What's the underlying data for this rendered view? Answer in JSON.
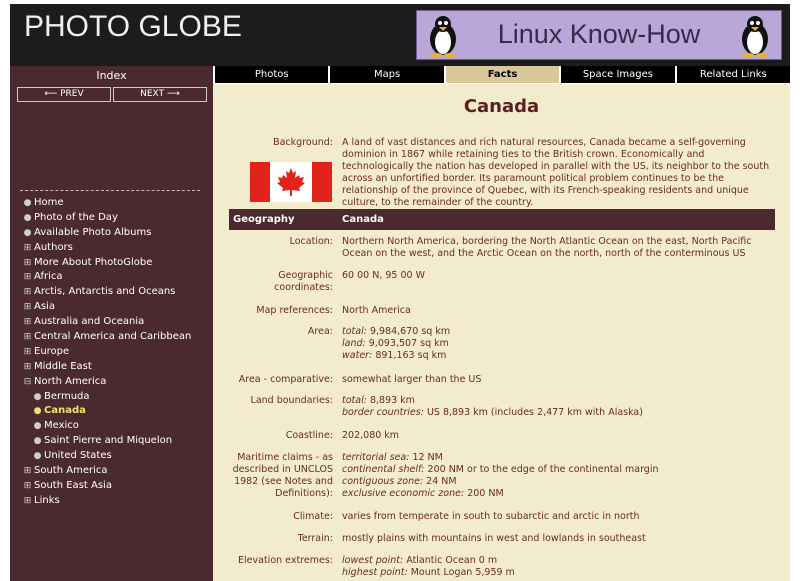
{
  "header": {
    "logo": "PHOTO GLOBE",
    "banner": "Linux Know-How"
  },
  "sidebar": {
    "index_label": "Index",
    "prev_label": "PREV",
    "next_label": "NEXT",
    "items": [
      {
        "label": "Home",
        "marker": "bullet"
      },
      {
        "label": "Photo of the Day",
        "marker": "bullet"
      },
      {
        "label": "Available Photo Albums",
        "marker": "bullet"
      },
      {
        "label": "Authors",
        "marker": "plus"
      },
      {
        "label": "More About PhotoGlobe",
        "marker": "plus"
      },
      {
        "label": "Africa",
        "marker": "plus"
      },
      {
        "label": "Arctis, Antarctis and Oceans",
        "marker": "plus"
      },
      {
        "label": "Asia",
        "marker": "plus"
      },
      {
        "label": "Australia and Oceania",
        "marker": "plus"
      },
      {
        "label": "Central America and Caribbean",
        "marker": "plus"
      },
      {
        "label": "Europe",
        "marker": "plus"
      },
      {
        "label": "Middle East",
        "marker": "plus"
      },
      {
        "label": "North America",
        "marker": "minus"
      },
      {
        "label": "Bermuda",
        "marker": "bullet",
        "sub": true
      },
      {
        "label": "Canada",
        "marker": "bullet",
        "sub": true,
        "active": true
      },
      {
        "label": "Mexico",
        "marker": "bullet",
        "sub": true
      },
      {
        "label": "Saint Pierre and Miquelon",
        "marker": "bullet",
        "sub": true
      },
      {
        "label": "United States",
        "marker": "bullet",
        "sub": true
      },
      {
        "label": "South America",
        "marker": "plus"
      },
      {
        "label": "South East Asia",
        "marker": "plus"
      },
      {
        "label": "Links",
        "marker": "plus"
      }
    ]
  },
  "tabs": [
    "Photos",
    "Maps",
    "Facts",
    "Space Images",
    "Related Links"
  ],
  "active_tab": "Facts",
  "content": {
    "title": "Canada",
    "background_label": "Background:",
    "background_text": "A land of vast distances and rich natural resources, Canada became a self-governing dominion in 1867 while retaining ties to the British crown. Economically and technologically the nation has developed in parallel with the US, its neighbor to the south across an unfortified border. Its paramount political problem continues to be the relationship of the province of Quebec, with its French-speaking residents and unique culture, to the remainder of the country.",
    "section_left": "Geography",
    "section_right": "Canada",
    "location_label": "Location:",
    "location_text": "Northern North America, bordering the North Atlantic Ocean on the east, North Pacific Ocean on the west, and the Arctic Ocean on the north, north of the conterminous US",
    "geo_label": "Geographic coordinates:",
    "geo_text": "60 00 N, 95 00 W",
    "mapref_label": "Map references:",
    "mapref_text": "North America",
    "area_label": "Area:",
    "area_total_k": "total:",
    "area_total_v": "9,984,670 sq km",
    "area_land_k": "land:",
    "area_land_v": "9,093,507 sq km",
    "area_water_k": "water:",
    "area_water_v": "891,163 sq km",
    "areacomp_label": "Area - comparative:",
    "areacomp_text": "somewhat larger than the US",
    "landb_label": "Land boundaries:",
    "landb_total_k": "total:",
    "landb_total_v": "8,893 km",
    "landb_border_k": "border countries:",
    "landb_border_v": "US 8,893 km (includes 2,477 km with Alaska)",
    "coast_label": "Coastline:",
    "coast_text": "202,080 km",
    "maritime_label": "Maritime claims - as described in UNCLOS 1982 (see Notes and Definitions):",
    "mar_terr_k": "territorial sea:",
    "mar_terr_v": "12 NM",
    "mar_shelf_k": "continental shelf:",
    "mar_shelf_v": "200 NM or to the edge of the continental margin",
    "mar_contig_k": "contiguous zone:",
    "mar_contig_v": "24 NM",
    "mar_eez_k": "exclusive economic zone:",
    "mar_eez_v": "200 NM",
    "climate_label": "Climate:",
    "climate_text": "varies from temperate in south to subarctic and arctic in north",
    "terrain_label": "Terrain:",
    "terrain_text": "mostly plains with mountains in west and lowlands in southeast",
    "elev_label": "Elevation extremes:",
    "elev_low_k": "lowest point:",
    "elev_low_v": "Atlantic Ocean 0 m",
    "elev_high_k": "highest point:",
    "elev_high_v": "Mount Logan 5,959 m"
  }
}
